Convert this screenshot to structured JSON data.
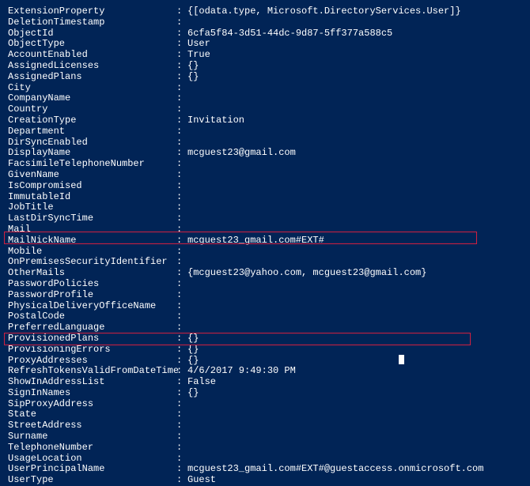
{
  "rows": [
    {
      "k": "ExtensionProperty",
      "v": "{[odata.type, Microsoft.DirectoryServices.User]}"
    },
    {
      "k": "DeletionTimestamp",
      "v": ""
    },
    {
      "k": "ObjectId",
      "v": "6cfa5f84-3d51-44dc-9d87-5ff377a588c5"
    },
    {
      "k": "ObjectType",
      "v": "User"
    },
    {
      "k": "AccountEnabled",
      "v": "True"
    },
    {
      "k": "AssignedLicenses",
      "v": "{}"
    },
    {
      "k": "AssignedPlans",
      "v": "{}"
    },
    {
      "k": "City",
      "v": ""
    },
    {
      "k": "CompanyName",
      "v": ""
    },
    {
      "k": "Country",
      "v": ""
    },
    {
      "k": "CreationType",
      "v": "Invitation"
    },
    {
      "k": "Department",
      "v": ""
    },
    {
      "k": "DirSyncEnabled",
      "v": ""
    },
    {
      "k": "DisplayName",
      "v": "mcguest23@gmail.com"
    },
    {
      "k": "FacsimileTelephoneNumber",
      "v": ""
    },
    {
      "k": "GivenName",
      "v": ""
    },
    {
      "k": "IsCompromised",
      "v": ""
    },
    {
      "k": "ImmutableId",
      "v": ""
    },
    {
      "k": "JobTitle",
      "v": ""
    },
    {
      "k": "LastDirSyncTime",
      "v": ""
    },
    {
      "k": "Mail",
      "v": ""
    },
    {
      "k": "MailNickName",
      "v": "mcguest23_gmail.com#EXT#"
    },
    {
      "k": "Mobile",
      "v": ""
    },
    {
      "k": "OnPremisesSecurityIdentifier",
      "v": ""
    },
    {
      "k": "OtherMails",
      "v": "{mcguest23@yahoo.com, mcguest23@gmail.com}"
    },
    {
      "k": "PasswordPolicies",
      "v": ""
    },
    {
      "k": "PasswordProfile",
      "v": ""
    },
    {
      "k": "PhysicalDeliveryOfficeName",
      "v": ""
    },
    {
      "k": "PostalCode",
      "v": ""
    },
    {
      "k": "PreferredLanguage",
      "v": ""
    },
    {
      "k": "ProvisionedPlans",
      "v": "{}"
    },
    {
      "k": "ProvisioningErrors",
      "v": "{}"
    },
    {
      "k": "ProxyAddresses",
      "v": "{}"
    },
    {
      "k": "RefreshTokensValidFromDateTime",
      "v": "4/6/2017 9:49:30 PM"
    },
    {
      "k": "ShowInAddressList",
      "v": "False"
    },
    {
      "k": "SignInNames",
      "v": "{}"
    },
    {
      "k": "SipProxyAddress",
      "v": ""
    },
    {
      "k": "State",
      "v": ""
    },
    {
      "k": "StreetAddress",
      "v": ""
    },
    {
      "k": "Surname",
      "v": ""
    },
    {
      "k": "TelephoneNumber",
      "v": ""
    },
    {
      "k": "UsageLocation",
      "v": ""
    },
    {
      "k": "UserPrincipalName",
      "v": "mcguest23_gmail.com#EXT#@guestaccess.onmicrosoft.com"
    },
    {
      "k": "UserType",
      "v": "Guest"
    }
  ],
  "separator": ":"
}
